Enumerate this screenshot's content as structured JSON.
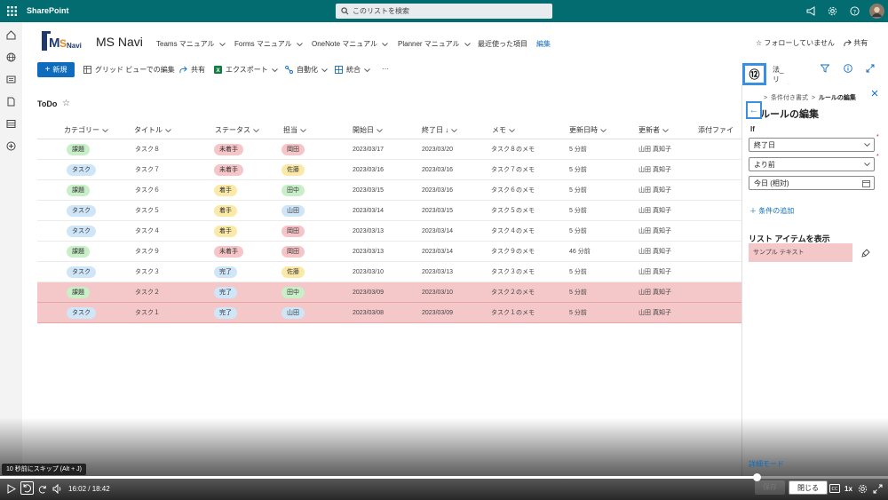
{
  "suitebar": {
    "brand": "SharePoint",
    "search_placeholder": "このリストを検索"
  },
  "site": {
    "title": "MS Navi",
    "logo_text": "MSNavi",
    "nav": [
      {
        "label": "Teams マニュアル"
      },
      {
        "label": "Forms マニュアル"
      },
      {
        "label": "OneNote マニュアル"
      },
      {
        "label": "Planner マニュアル"
      },
      {
        "label": "最近使った項目"
      },
      {
        "label": "編集"
      }
    ],
    "follow": "フォローしていません",
    "share": "共有"
  },
  "command_bar": {
    "new": "新規",
    "grid_edit": "グリッド ビューでの編集",
    "share": "共有",
    "export": "エクスポート",
    "automate": "自動化",
    "integrate": "統合",
    "more": "···",
    "view": "法_リスト"
  },
  "list": {
    "title": "ToDo",
    "columns": [
      "カテゴリー",
      "タイトル",
      "ステータス",
      "担当",
      "開始日",
      "終了日 ↓",
      "メモ",
      "更新日時",
      "更新者",
      "添付ファイ"
    ],
    "rows": [
      {
        "category": "課題",
        "title": "タスク８",
        "status": "未着手",
        "owner": "岡田",
        "start": "2023/03/17",
        "end": "2023/03/20",
        "memo": "タスク８のメモ",
        "updated": "5 分前",
        "editor": "山田 真知子",
        "hl": false
      },
      {
        "category": "タスク",
        "title": "タスク７",
        "status": "未着手",
        "owner": "佐藤",
        "start": "2023/03/16",
        "end": "2023/03/16",
        "memo": "タスク７のメモ",
        "updated": "5 分前",
        "editor": "山田 真知子",
        "hl": false
      },
      {
        "category": "課題",
        "title": "タスク６",
        "status": "着手",
        "owner": "田中",
        "start": "2023/03/15",
        "end": "2023/03/16",
        "memo": "タスク６のメモ",
        "updated": "5 分前",
        "editor": "山田 真知子",
        "hl": false
      },
      {
        "category": "タスク",
        "title": "タスク５",
        "status": "着手",
        "owner": "山田",
        "start": "2023/03/14",
        "end": "2023/03/15",
        "memo": "タスク５のメモ",
        "updated": "5 分前",
        "editor": "山田 真知子",
        "hl": false
      },
      {
        "category": "タスク",
        "title": "タスク４",
        "status": "着手",
        "owner": "岡田",
        "start": "2023/03/13",
        "end": "2023/03/14",
        "memo": "タスク４のメモ",
        "updated": "5 分前",
        "editor": "山田 真知子",
        "hl": false
      },
      {
        "category": "課題",
        "title": "タスク９",
        "status": "未着手",
        "owner": "岡田",
        "start": "2023/03/13",
        "end": "2023/03/14",
        "memo": "タスク９のメモ",
        "updated": "46 分前",
        "editor": "山田 真知子",
        "hl": false
      },
      {
        "category": "タスク",
        "title": "タスク３",
        "status": "完了",
        "owner": "佐藤",
        "start": "2023/03/10",
        "end": "2023/03/13",
        "memo": "タスク３のメモ",
        "updated": "5 分前",
        "editor": "山田 真知子",
        "hl": false
      },
      {
        "category": "課題",
        "title": "タスク２",
        "status": "完了",
        "owner": "田中",
        "start": "2023/03/09",
        "end": "2023/03/10",
        "memo": "タスク２のメモ",
        "updated": "5 分前",
        "editor": "山田 真知子",
        "hl": true
      },
      {
        "category": "タスク",
        "title": "タスク１",
        "status": "完了",
        "owner": "山田",
        "start": "2023/03/08",
        "end": "2023/03/09",
        "memo": "タスク１のメモ",
        "updated": "5 分前",
        "editor": "山田 真知子",
        "hl": true
      }
    ]
  },
  "colors": {
    "category": {
      "課題": "#c9efc9",
      "タスク": "#cfe6f8"
    },
    "status": {
      "未着手": "#f6c5c8",
      "着手": "#fbe9a8",
      "完了": "#cfe6f8"
    },
    "owner": {
      "岡田": "#f6c5c8",
      "佐藤": "#fbe9a8",
      "田中": "#c9efc9",
      "山田": "#cfe6f8"
    }
  },
  "panel": {
    "breadcrumb_parent": "条件付き書式",
    "breadcrumb_current": "ルールの編集",
    "title": "ルールの編集",
    "if_label": "If",
    "field": "終了日",
    "operator": "より前",
    "value": "今日 (相対)",
    "add_condition": "条件の追加",
    "show_items": "リスト アイテムを表示",
    "sample": "サンプル テキスト",
    "advanced": "詳細モード",
    "save": "保存",
    "close": "閉じる"
  },
  "callout": {
    "number": "⑫"
  },
  "video": {
    "tooltip": "10 秒前にスキップ (Alt + J)",
    "time": "16:02 / 18:42",
    "progress": 0.852,
    "speed": "1x"
  }
}
